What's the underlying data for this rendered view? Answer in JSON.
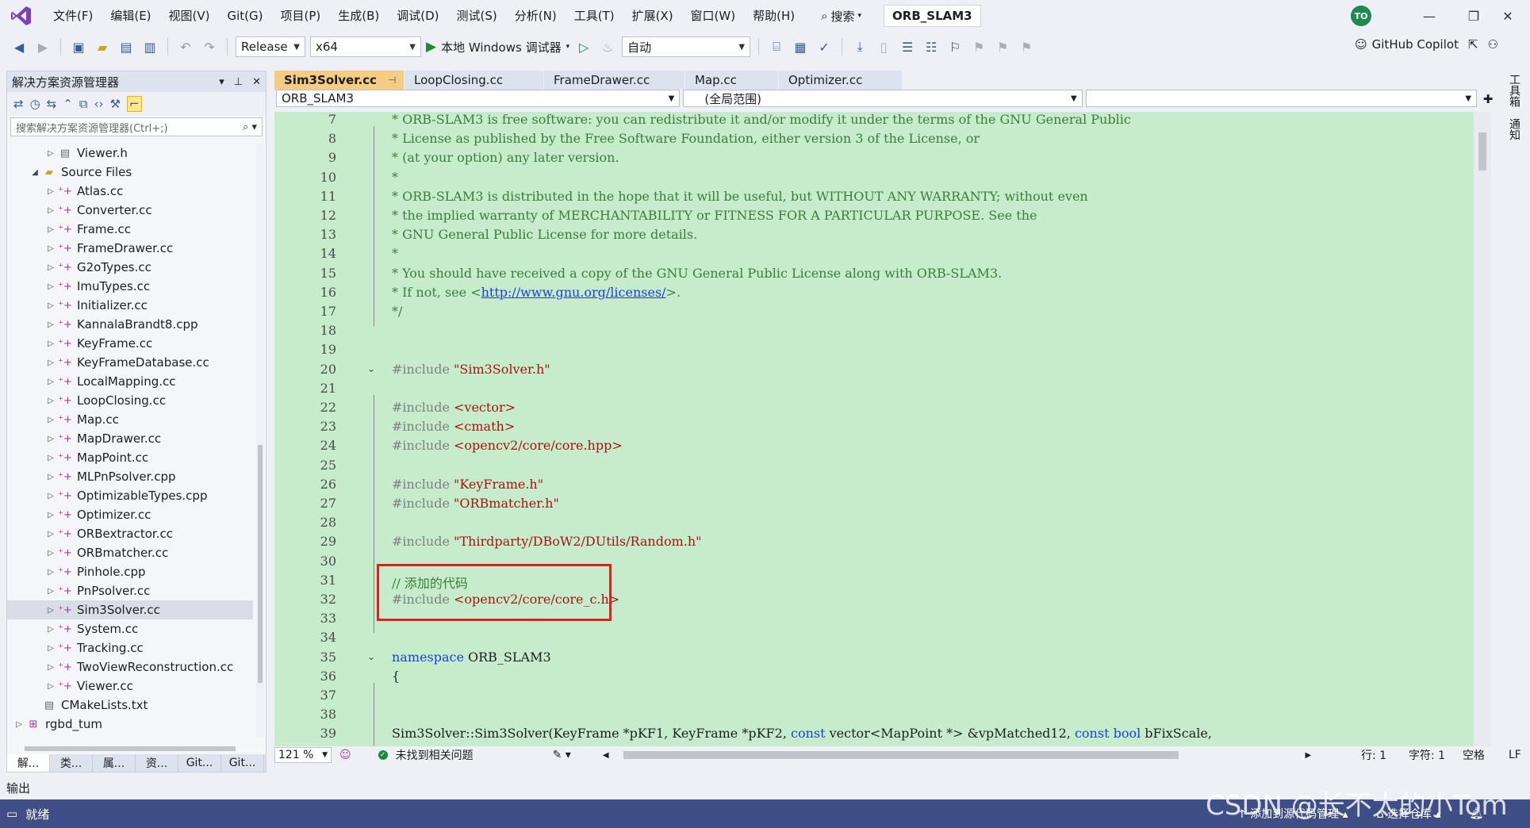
{
  "menubar": {
    "items": [
      "文件(F)",
      "编辑(E)",
      "视图(V)",
      "Git(G)",
      "项目(P)",
      "生成(B)",
      "调试(D)",
      "测试(S)",
      "分析(N)",
      "工具(T)",
      "扩展(X)",
      "窗口(W)",
      "帮助(H)"
    ],
    "search_label": "搜索",
    "solution_name": "ORB_SLAM3",
    "avatar_initials": "TO"
  },
  "toolbar": {
    "config": "Release",
    "platform": "x64",
    "debugger_label": "本地 Windows 调试器",
    "auto_label": "自动",
    "copilot_label": "GitHub Copilot"
  },
  "explorer": {
    "title": "解决方案资源管理器",
    "search_placeholder": "搜索解决方案资源管理器(Ctrl+;)",
    "items": [
      {
        "label": "Viewer.h",
        "kind": "h",
        "indent": 2,
        "caret": "▷"
      },
      {
        "label": "Source Files",
        "kind": "folder",
        "indent": 1,
        "caret": "◢"
      },
      {
        "label": "Atlas.cc",
        "kind": "cc",
        "indent": 2,
        "caret": "▷"
      },
      {
        "label": "Converter.cc",
        "kind": "cc",
        "indent": 2,
        "caret": "▷"
      },
      {
        "label": "Frame.cc",
        "kind": "cc",
        "indent": 2,
        "caret": "▷"
      },
      {
        "label": "FrameDrawer.cc",
        "kind": "cc",
        "indent": 2,
        "caret": "▷"
      },
      {
        "label": "G2oTypes.cc",
        "kind": "cc",
        "indent": 2,
        "caret": "▷"
      },
      {
        "label": "ImuTypes.cc",
        "kind": "cc",
        "indent": 2,
        "caret": "▷"
      },
      {
        "label": "Initializer.cc",
        "kind": "cc",
        "indent": 2,
        "caret": "▷"
      },
      {
        "label": "KannalaBrandt8.cpp",
        "kind": "cc",
        "indent": 2,
        "caret": "▷"
      },
      {
        "label": "KeyFrame.cc",
        "kind": "cc",
        "indent": 2,
        "caret": "▷"
      },
      {
        "label": "KeyFrameDatabase.cc",
        "kind": "cc",
        "indent": 2,
        "caret": "▷"
      },
      {
        "label": "LocalMapping.cc",
        "kind": "cc",
        "indent": 2,
        "caret": "▷"
      },
      {
        "label": "LoopClosing.cc",
        "kind": "cc",
        "indent": 2,
        "caret": "▷"
      },
      {
        "label": "Map.cc",
        "kind": "cc",
        "indent": 2,
        "caret": "▷"
      },
      {
        "label": "MapDrawer.cc",
        "kind": "cc",
        "indent": 2,
        "caret": "▷"
      },
      {
        "label": "MapPoint.cc",
        "kind": "cc",
        "indent": 2,
        "caret": "▷"
      },
      {
        "label": "MLPnPsolver.cpp",
        "kind": "cc",
        "indent": 2,
        "caret": "▷"
      },
      {
        "label": "OptimizableTypes.cpp",
        "kind": "cc",
        "indent": 2,
        "caret": "▷"
      },
      {
        "label": "Optimizer.cc",
        "kind": "cc",
        "indent": 2,
        "caret": "▷"
      },
      {
        "label": "ORBextractor.cc",
        "kind": "cc",
        "indent": 2,
        "caret": "▷"
      },
      {
        "label": "ORBmatcher.cc",
        "kind": "cc",
        "indent": 2,
        "caret": "▷"
      },
      {
        "label": "Pinhole.cpp",
        "kind": "cc",
        "indent": 2,
        "caret": "▷"
      },
      {
        "label": "PnPsolver.cc",
        "kind": "cc",
        "indent": 2,
        "caret": "▷"
      },
      {
        "label": "Sim3Solver.cc",
        "kind": "cc",
        "indent": 2,
        "caret": "▷",
        "selected": true
      },
      {
        "label": "System.cc",
        "kind": "cc",
        "indent": 2,
        "caret": "▷"
      },
      {
        "label": "Tracking.cc",
        "kind": "cc",
        "indent": 2,
        "caret": "▷"
      },
      {
        "label": "TwoViewReconstruction.cc",
        "kind": "cc",
        "indent": 2,
        "caret": "▷"
      },
      {
        "label": "Viewer.cc",
        "kind": "cc",
        "indent": 2,
        "caret": "▷"
      },
      {
        "label": "CMakeLists.txt",
        "kind": "txt",
        "indent": 1,
        "caret": ""
      },
      {
        "label": "rgbd_tum",
        "kind": "project",
        "indent": 0,
        "caret": "▷"
      }
    ],
    "bottom_tabs": [
      "解...",
      "类...",
      "属...",
      "资...",
      "Git...",
      "Git..."
    ]
  },
  "editor": {
    "tabs": [
      {
        "label": "Sim3Solver.cc",
        "active": true
      },
      {
        "label": "LoopClosing.cc",
        "active": false
      },
      {
        "label": "FrameDrawer.cc",
        "active": false
      },
      {
        "label": "Map.cc",
        "active": false
      },
      {
        "label": "Optimizer.cc",
        "active": false
      }
    ],
    "nav_project": "ORB_SLAM3",
    "nav_scope": "(全局范围)",
    "lines": [
      {
        "n": "7",
        "parts": [
          {
            "t": "* ORB-SLAM3 is free software: you can redistribute it and/or modify it under the terms of the GNU General Public",
            "c": "c-comment"
          }
        ]
      },
      {
        "n": "8",
        "parts": [
          {
            "t": "* License as published by the Free Software Foundation, either version 3 of the License, or",
            "c": "c-comment"
          }
        ]
      },
      {
        "n": "9",
        "parts": [
          {
            "t": "* (at your option) any later version.",
            "c": "c-comment"
          }
        ]
      },
      {
        "n": "10",
        "parts": [
          {
            "t": "*",
            "c": "c-comment"
          }
        ]
      },
      {
        "n": "11",
        "parts": [
          {
            "t": "* ORB-SLAM3 is distributed in the hope that it will be useful, but WITHOUT ANY WARRANTY; without even",
            "c": "c-comment"
          }
        ]
      },
      {
        "n": "12",
        "parts": [
          {
            "t": "* the implied warranty of MERCHANTABILITY or FITNESS FOR A PARTICULAR PURPOSE. See the",
            "c": "c-comment"
          }
        ]
      },
      {
        "n": "13",
        "parts": [
          {
            "t": "* GNU General Public License for more details.",
            "c": "c-comment"
          }
        ]
      },
      {
        "n": "14",
        "parts": [
          {
            "t": "*",
            "c": "c-comment"
          }
        ]
      },
      {
        "n": "15",
        "parts": [
          {
            "t": "* You should have received a copy of the GNU General Public License along with ORB-SLAM3.",
            "c": "c-comment"
          }
        ]
      },
      {
        "n": "16",
        "parts": [
          {
            "t": "* If not, see <",
            "c": "c-comment"
          },
          {
            "t": "http://www.gnu.org/licenses/",
            "c": "c-link"
          },
          {
            "t": ">.",
            "c": "c-comment"
          }
        ]
      },
      {
        "n": "17",
        "parts": [
          {
            "t": "*/",
            "c": "c-comment"
          }
        ]
      },
      {
        "n": "18",
        "parts": []
      },
      {
        "n": "19",
        "parts": []
      },
      {
        "n": "20",
        "parts": [
          {
            "t": "#include ",
            "c": "c-pre"
          },
          {
            "t": "\"Sim3Solver.h\"",
            "c": "c-str"
          }
        ]
      },
      {
        "n": "21",
        "parts": []
      },
      {
        "n": "22",
        "parts": [
          {
            "t": "#include ",
            "c": "c-pre"
          },
          {
            "t": "<vector>",
            "c": "c-str"
          }
        ]
      },
      {
        "n": "23",
        "parts": [
          {
            "t": "#include ",
            "c": "c-pre"
          },
          {
            "t": "<cmath>",
            "c": "c-str"
          }
        ]
      },
      {
        "n": "24",
        "parts": [
          {
            "t": "#include ",
            "c": "c-pre"
          },
          {
            "t": "<opencv2/core/core.hpp>",
            "c": "c-str"
          }
        ]
      },
      {
        "n": "25",
        "parts": []
      },
      {
        "n": "26",
        "parts": [
          {
            "t": "#include ",
            "c": "c-pre"
          },
          {
            "t": "\"KeyFrame.h\"",
            "c": "c-str"
          }
        ]
      },
      {
        "n": "27",
        "parts": [
          {
            "t": "#include ",
            "c": "c-pre"
          },
          {
            "t": "\"ORBmatcher.h\"",
            "c": "c-str"
          }
        ]
      },
      {
        "n": "28",
        "parts": []
      },
      {
        "n": "29",
        "parts": [
          {
            "t": "#include ",
            "c": "c-pre"
          },
          {
            "t": "\"Thirdparty/DBoW2/DUtils/Random.h\"",
            "c": "c-str"
          }
        ]
      },
      {
        "n": "30",
        "parts": []
      },
      {
        "n": "31",
        "parts": [
          {
            "t": "// 添加的代码",
            "c": "c-comment"
          }
        ]
      },
      {
        "n": "32",
        "parts": [
          {
            "t": "#include ",
            "c": "c-pre"
          },
          {
            "t": "<opencv2/core/core_c.h>",
            "c": "c-str"
          }
        ]
      },
      {
        "n": "33",
        "parts": []
      },
      {
        "n": "34",
        "parts": []
      },
      {
        "n": "35",
        "parts": [
          {
            "t": "namespace ",
            "c": "c-kw"
          },
          {
            "t": "ORB_SLAM3",
            "c": ""
          }
        ]
      },
      {
        "n": "36",
        "parts": [
          {
            "t": "{",
            "c": ""
          }
        ]
      },
      {
        "n": "37",
        "parts": []
      },
      {
        "n": "38",
        "parts": []
      },
      {
        "n": "39",
        "parts": [
          {
            "t": "Sim3Solver::Sim3Solver(KeyFrame *pKF1, KeyFrame *pKF2, ",
            "c": ""
          },
          {
            "t": "const ",
            "c": "c-kw"
          },
          {
            "t": "vector<MapPoint *> &vpMatched12, ",
            "c": ""
          },
          {
            "t": "const bool ",
            "c": "c-kw"
          },
          {
            "t": "bFixScale,",
            "c": ""
          }
        ]
      }
    ],
    "zoom": "121 %",
    "issues": "未找到相关问题",
    "line_label": "行: 1",
    "char_label": "字符: 1",
    "space_label": "空格",
    "eol_label": "LF"
  },
  "right_rail": [
    "工具箱",
    "通知"
  ],
  "output_label": "输出",
  "status": {
    "ready": "就绪",
    "add_to_source": "添加到源代码管理",
    "select_repo": "选择仓库"
  },
  "watermark": "CSDN @长不太的小Tom",
  "colors": {
    "editor_bg": "#c7eccb",
    "active_tab": "#f5cc84",
    "status_bar": "#3f4e86",
    "highlight_border": "#e02020"
  }
}
